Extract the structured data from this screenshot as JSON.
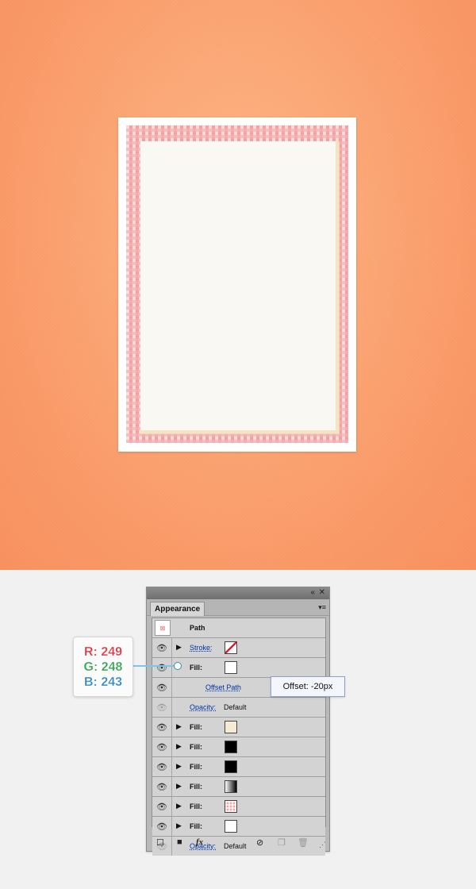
{
  "panel": {
    "tab": "Appearance",
    "title": "Path",
    "rows": [
      {
        "label": "Stroke:",
        "link": true,
        "arrow": true,
        "swatch": "stroke-none"
      },
      {
        "label": "Fill:",
        "link": false,
        "arrow": false,
        "swatch": "#ffffff"
      },
      {
        "label": "Offset Path",
        "sub": true,
        "link": true
      },
      {
        "label": "Opacity:",
        "sub": true,
        "link": true,
        "value": "Default"
      },
      {
        "label": "Fill:",
        "arrow": true,
        "swatch": "#f7ead2"
      },
      {
        "label": "Fill:",
        "arrow": true,
        "swatch": "#000000"
      },
      {
        "label": "Fill:",
        "arrow": true,
        "swatch": "#000000"
      },
      {
        "label": "Fill:",
        "arrow": true,
        "swatch": "gradient"
      },
      {
        "label": "Fill:",
        "arrow": true,
        "swatch": "gingham"
      },
      {
        "label": "Fill:",
        "arrow": true,
        "swatch": "#ffffff"
      }
    ],
    "opacity_label": "Opacity:",
    "opacity_value": "Default",
    "fx_label": "fx"
  },
  "tooltip": "Offset: -20px",
  "rgb": {
    "r": "R: 249",
    "g": "G: 248",
    "b": "B: 243"
  },
  "colors": {
    "r": "#e0323c",
    "g": "#2fa14a",
    "b": "#2a86c5",
    "canvas": "#f99866"
  }
}
